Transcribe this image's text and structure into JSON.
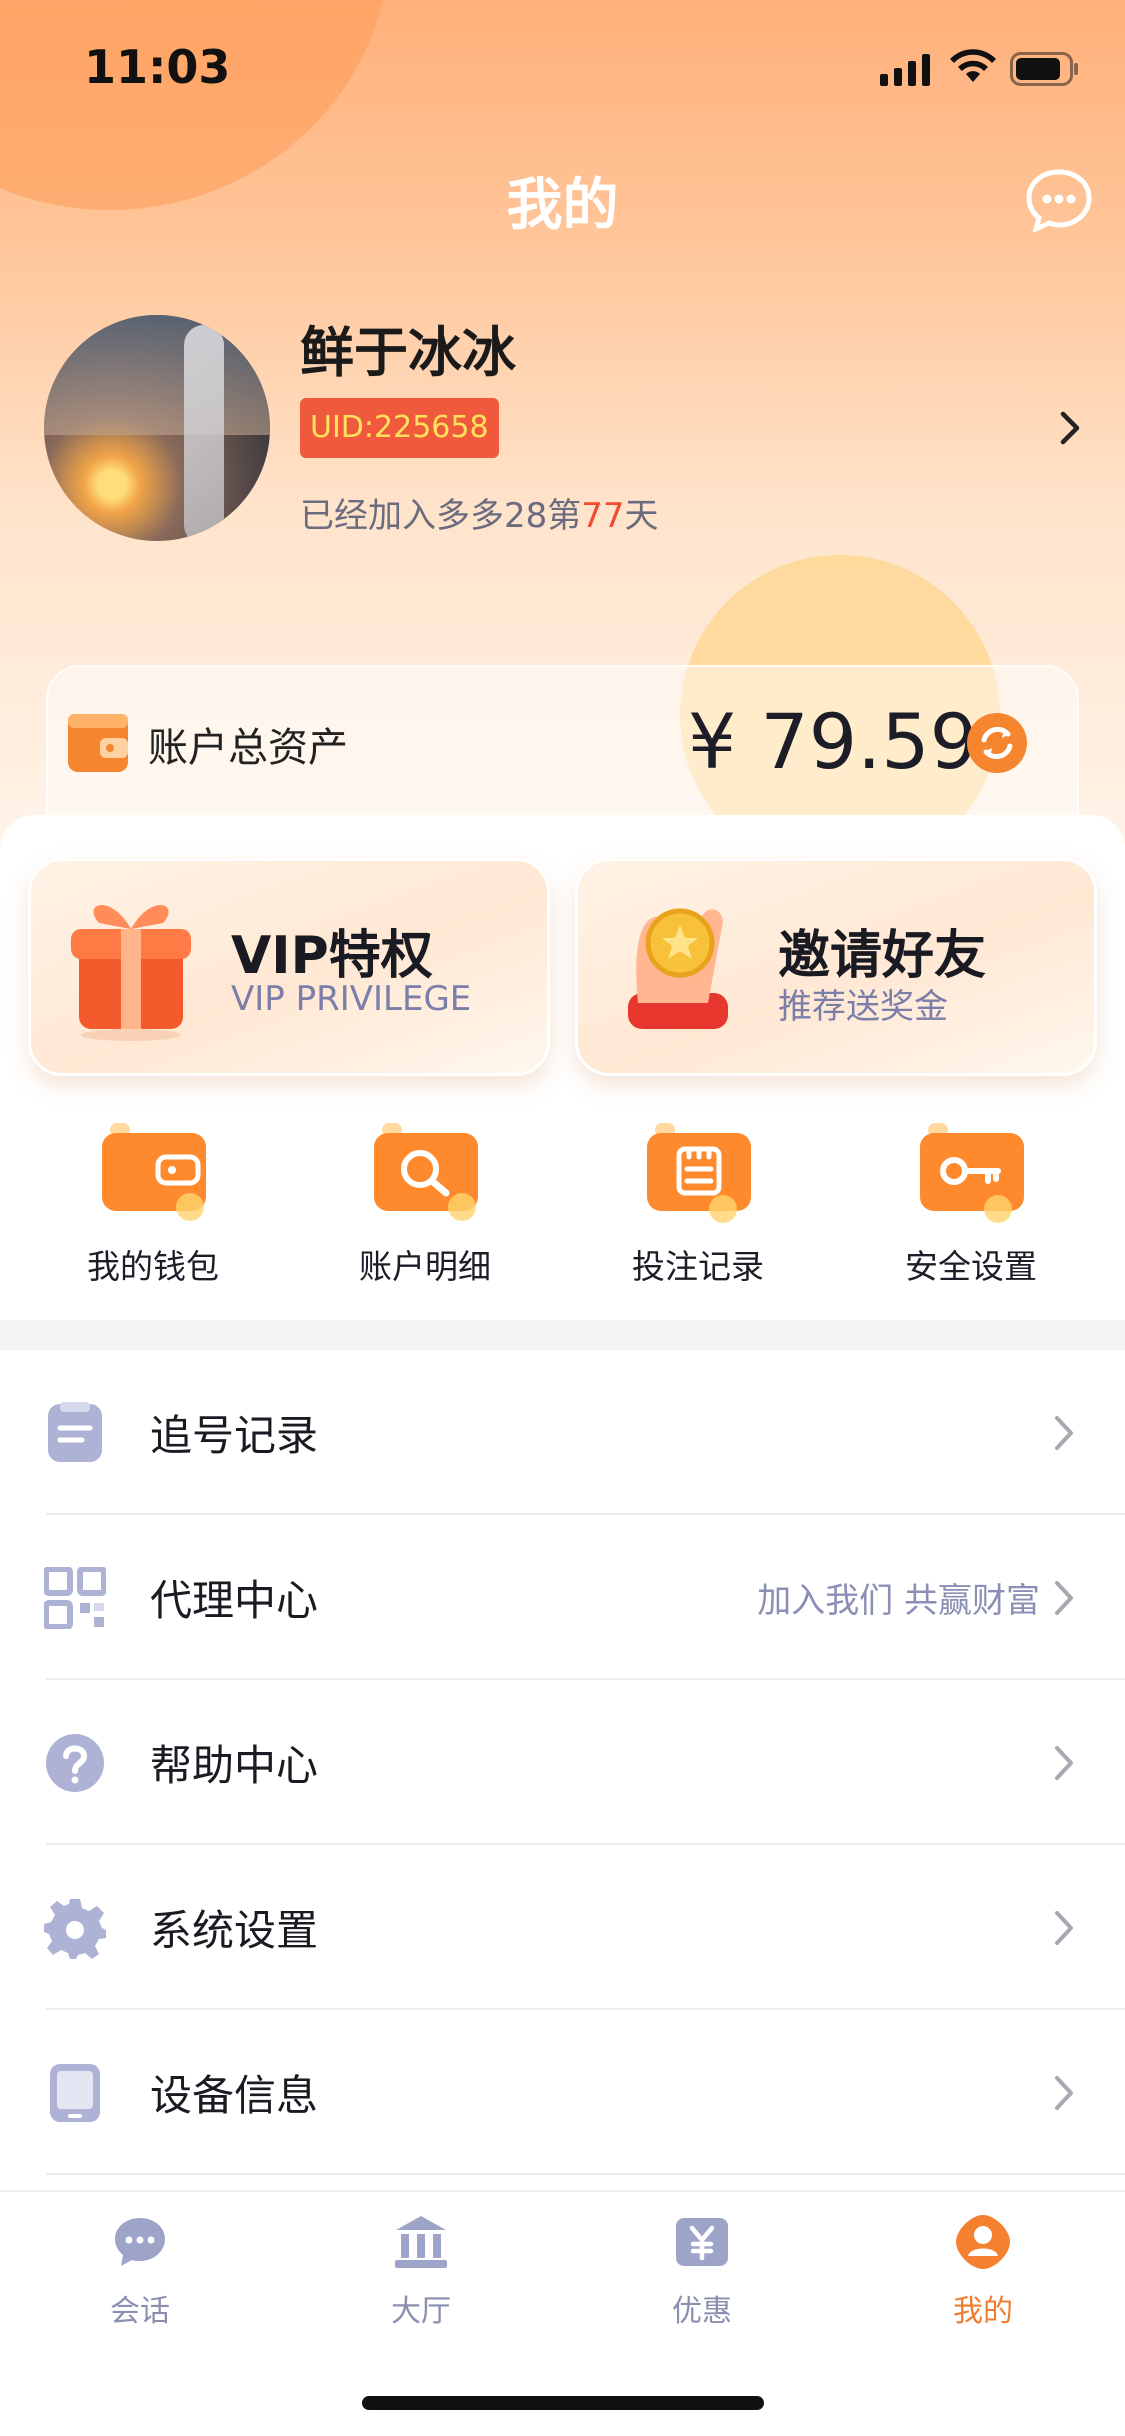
{
  "status_bar": {
    "time": "11:03"
  },
  "header": {
    "title": "我的"
  },
  "profile": {
    "name": "鲜于冰冰",
    "uid": "UID:225658",
    "join_prefix": "已经加入多多28第",
    "join_days": "77",
    "join_suffix": "天"
  },
  "assets": {
    "label": "账户总资产",
    "amount": "¥ 79.59"
  },
  "promos": [
    {
      "title": "VIP特权",
      "subtitle": "VIP PRIVILEGE"
    },
    {
      "title": "邀请好友",
      "subtitle": "推荐送奖金"
    }
  ],
  "quick_actions": [
    {
      "label": "我的钱包",
      "icon": "wallet-icon"
    },
    {
      "label": "账户明细",
      "icon": "magnifier-icon"
    },
    {
      "label": "投注记录",
      "icon": "clipboard-icon"
    },
    {
      "label": "安全设置",
      "icon": "key-icon"
    }
  ],
  "menu": [
    {
      "label": "追号记录",
      "note": "",
      "icon": "document-icon"
    },
    {
      "label": "代理中心",
      "note": "加入我们 共赢财富",
      "icon": "qr-code-icon"
    },
    {
      "label": "帮助中心",
      "note": "",
      "icon": "question-icon"
    },
    {
      "label": "系统设置",
      "note": "",
      "icon": "gear-icon"
    },
    {
      "label": "设备信息",
      "note": "",
      "icon": "tablet-icon"
    }
  ],
  "tabs": [
    {
      "label": "会话",
      "icon": "chat-icon"
    },
    {
      "label": "大厅",
      "icon": "hall-icon"
    },
    {
      "label": "优惠",
      "icon": "coupon-icon"
    },
    {
      "label": "我的",
      "icon": "profile-icon"
    }
  ],
  "colors": {
    "accent": "#f07d2e",
    "uid_bg": "#f05a3c",
    "uid_text": "#ffe15c",
    "highlight": "#f04a30",
    "muted_icon": "#9ea3c8"
  }
}
